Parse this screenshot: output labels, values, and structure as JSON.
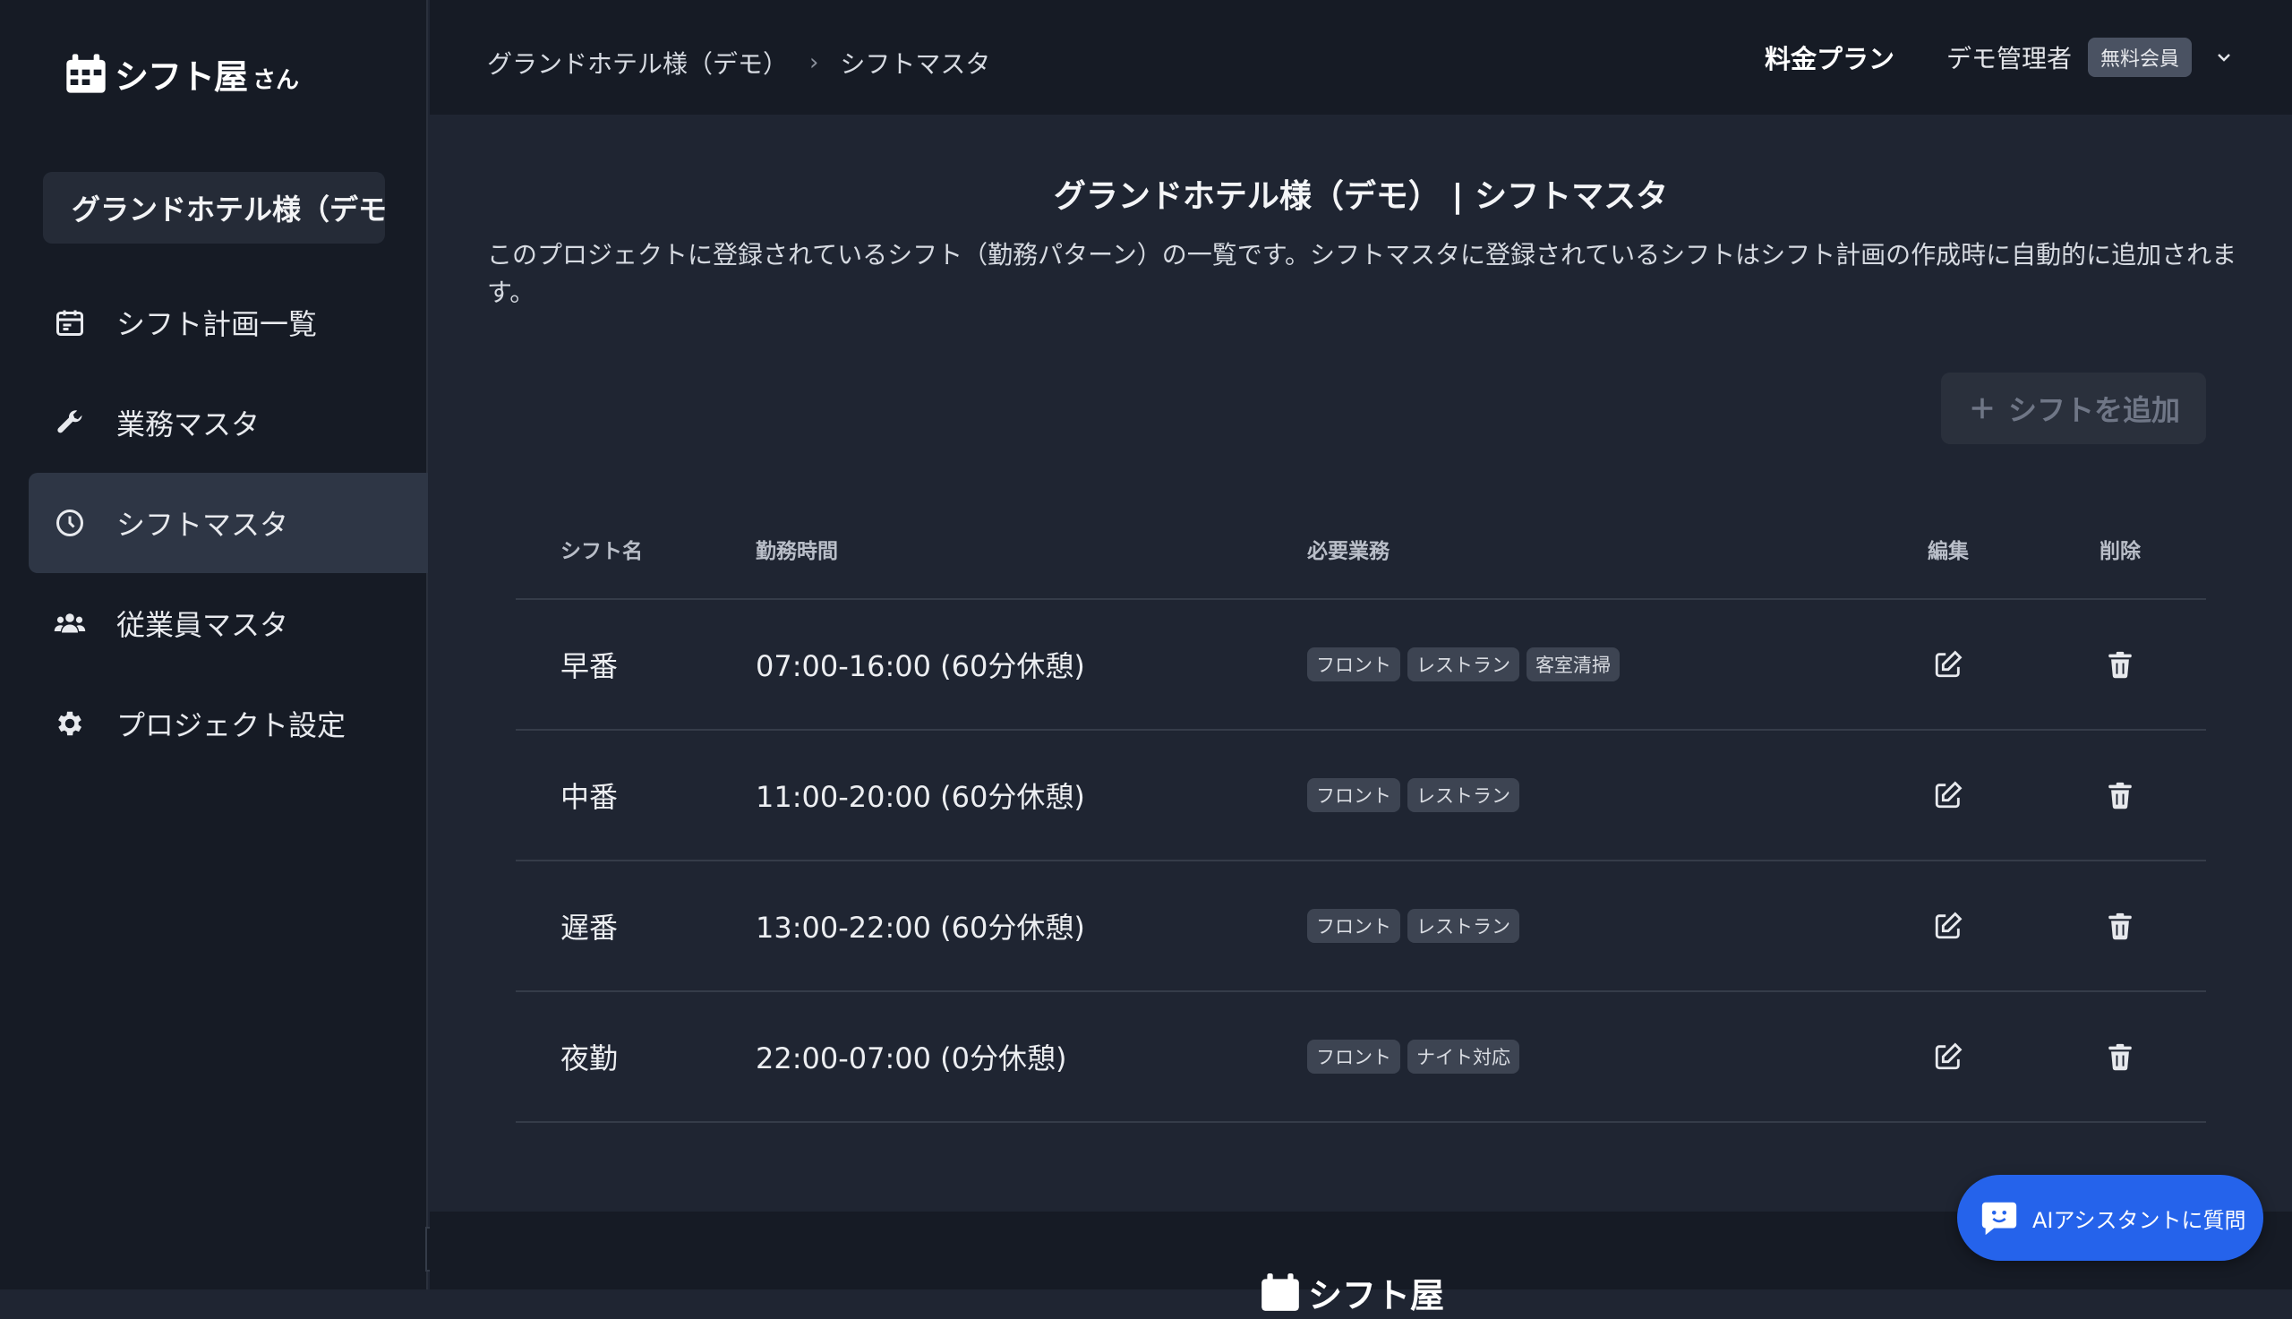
{
  "app": {
    "logo_text": "シフト屋",
    "logo_suffix": "さん"
  },
  "sidebar": {
    "project_name": "グランドホテル様（デモ）",
    "items": [
      {
        "label": "シフト計画一覧",
        "icon": "calendar-icon"
      },
      {
        "label": "業務マスタ",
        "icon": "wrench-icon"
      },
      {
        "label": "シフトマスタ",
        "icon": "clock-icon",
        "active": true
      },
      {
        "label": "従業員マスタ",
        "icon": "users-icon"
      },
      {
        "label": "プロジェクト設定",
        "icon": "gear-icon"
      }
    ]
  },
  "header": {
    "breadcrumb": [
      "グランドホテル様（デモ）",
      "シフトマスタ"
    ],
    "breadcrumb_separator": "›",
    "plan_link": "料金プラン",
    "user_name": "デモ管理者",
    "user_badge": "無料会員"
  },
  "main": {
    "title": "グランドホテル様（デモ） | シフトマスタ",
    "description": "このプロジェクトに登録されているシフト（勤務パターン）の一覧です。シフトマスタに登録されているシフトはシフト計画の作成時に自動的に追加されます。",
    "add_button": "シフトを追加",
    "table": {
      "headers": [
        "シフト名",
        "勤務時間",
        "必要業務",
        "編集",
        "削除"
      ],
      "rows": [
        {
          "name": "早番",
          "time": "07:00-16:00 (60分休憩)",
          "tags": [
            "フロント",
            "レストラン",
            "客室清掃"
          ]
        },
        {
          "name": "中番",
          "time": "11:00-20:00 (60分休憩)",
          "tags": [
            "フロント",
            "レストラン"
          ]
        },
        {
          "name": "遅番",
          "time": "13:00-22:00 (60分休憩)",
          "tags": [
            "フロント",
            "レストラン"
          ]
        },
        {
          "name": "夜勤",
          "time": "22:00-07:00 (0分休憩)",
          "tags": [
            "フロント",
            "ナイト対応"
          ]
        }
      ]
    }
  },
  "footer": {
    "logo_text": "シフト屋"
  },
  "ai_assistant": {
    "label": "AIアシスタントに質問"
  },
  "colors": {
    "sidebar_bg": "#161b25",
    "main_bg": "#1f2532",
    "active_nav": "#2e3645",
    "accent": "#2563eb"
  }
}
